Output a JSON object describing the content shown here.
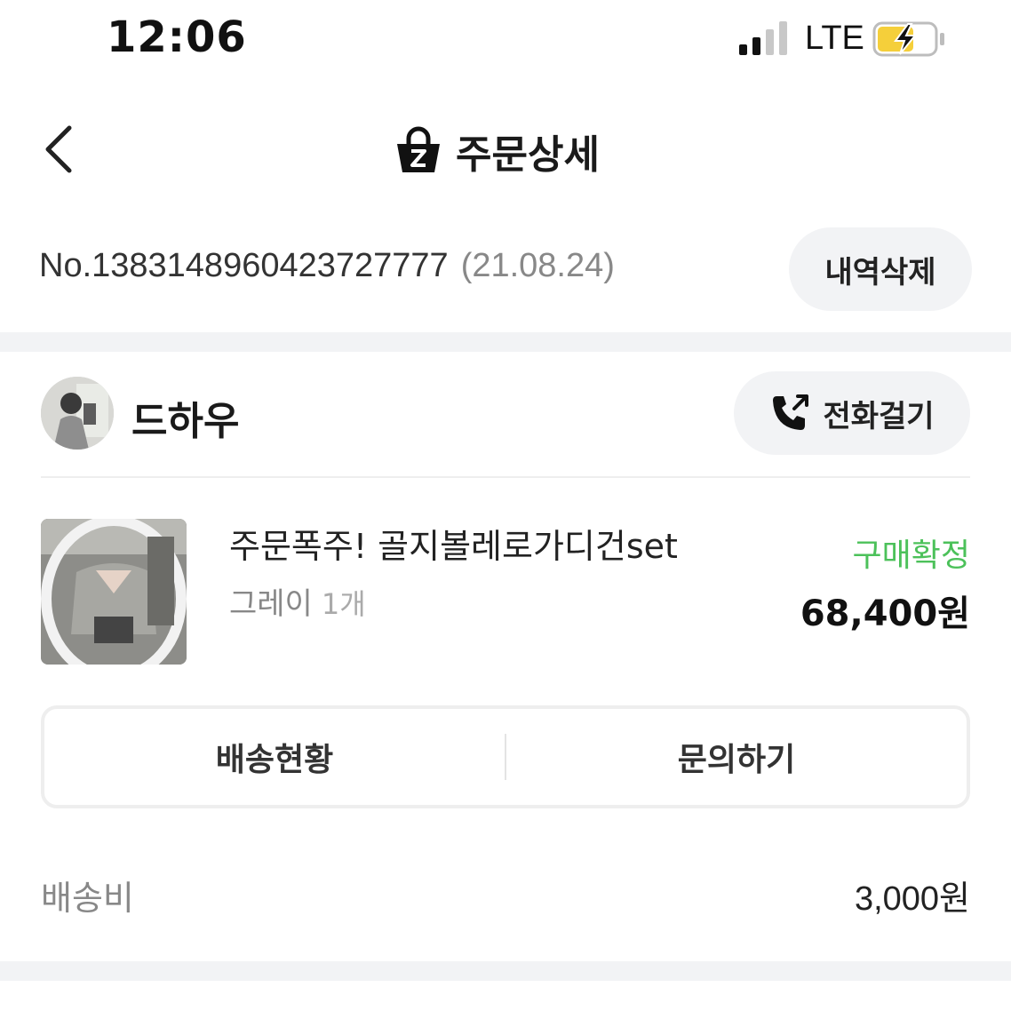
{
  "status_bar": {
    "time": "12:06",
    "network": "LTE",
    "icons": [
      "signal-icon",
      "battery-charging-icon"
    ],
    "battery_color": "#f5cf3a"
  },
  "nav": {
    "title": "주문상세",
    "icons": [
      "back-chevron-icon",
      "shopping-bag-z-icon"
    ]
  },
  "order": {
    "number": "No.1383148960423727777",
    "date": "(21.08.24)",
    "delete_label": "내역삭제"
  },
  "seller": {
    "name": "드하우",
    "call_label": "전화걸기",
    "call_icon": "phone-call-icon"
  },
  "product": {
    "name": "주문폭주! 골지볼레로가디건set",
    "option": "그레이",
    "quantity": "1개",
    "status": "구매확정",
    "status_color": "#4cc15a",
    "price": "68,400원"
  },
  "actions": {
    "shipping_status_label": "배송현황",
    "inquiry_label": "문의하기"
  },
  "shipping_fee": {
    "label": "배송비",
    "value": "3,000원"
  }
}
